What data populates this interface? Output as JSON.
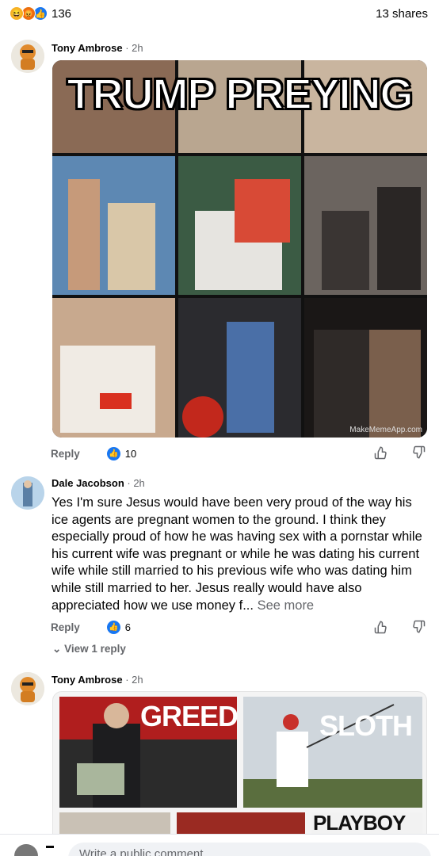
{
  "post_stats": {
    "reaction_count": "136",
    "shares": "13 shares",
    "reactions": [
      "haha-icon",
      "angry-icon",
      "like-icon"
    ]
  },
  "comments": [
    {
      "author": "Tony Ambrose",
      "time": "· 2h",
      "meme_title": "TRUMP PREYING",
      "watermark": "MakeMemeApp.com",
      "reply_label": "Reply",
      "likes": "10"
    },
    {
      "author": "Dale Jacobson",
      "time": "· 2h",
      "text": "Yes I'm sure Jesus would have been very proud of the way his ice agents are pregnant women to the ground. I think they especially proud of how he was having sex with a pornstar while his current wife was pregnant or while he was dating his current wife while still married to his previous wife who was dating him while still married to her. Jesus really would have also appreciated how we use money f...",
      "see_more": "See more",
      "reply_label": "Reply",
      "likes": "6",
      "view_replies": "View 1 reply"
    },
    {
      "author": "Tony Ambrose",
      "time": "· 2h",
      "meme_labels": [
        "GREED",
        "SLOTH",
        "PLAYBOY"
      ]
    }
  ],
  "composer": {
    "placeholder": "Write a public comment..."
  },
  "colors": {
    "accent": "#1877f2",
    "secondary_text": "#65676b"
  }
}
